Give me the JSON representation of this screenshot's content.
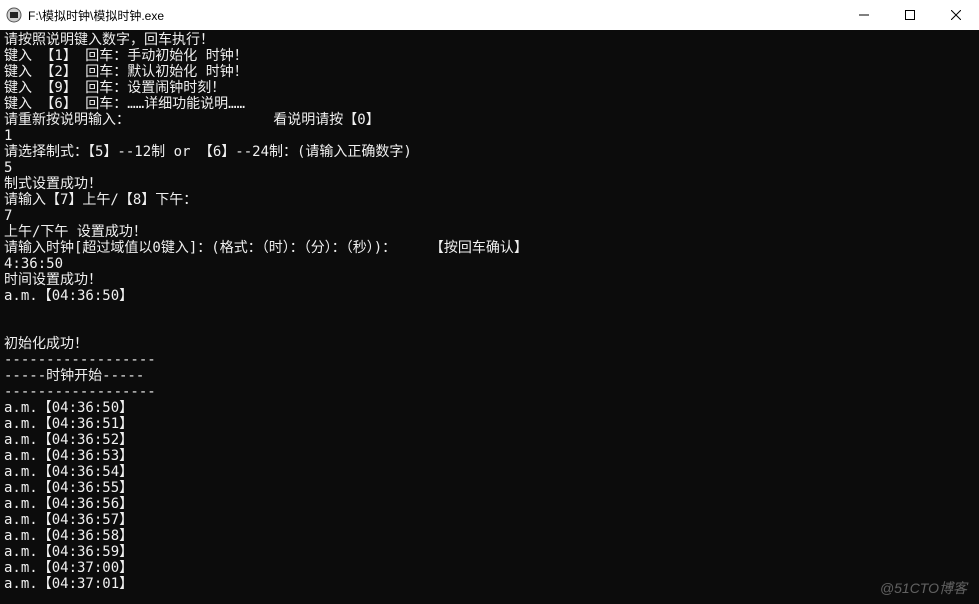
{
  "window": {
    "title": "F:\\模拟时钟\\模拟时钟.exe"
  },
  "controls": {
    "minimize": "—",
    "maximize": "□",
    "close": "×"
  },
  "console": {
    "lines": [
      "请按照说明键入数字，回车执行！",
      "键入 【1】 回车：手动初始化 时钟！",
      "键入 【2】 回车：默认初始化 时钟！",
      "键入 【9】 回车：设置闹钟时刻！",
      "键入 【6】 回车：……详细功能说明……",
      "请重新按说明输入：                 看说明请按【0】",
      "1",
      "请选择制式：【5】--12制 or 【6】--24制：(请输入正确数字)",
      "5",
      "制式设置成功！",
      "请输入【7】上午/【8】下午：",
      "7",
      "上午/下午 设置成功！",
      "请输入时钟[超过域值以0键入]：(格式：（时）：（分）：（秒）)：    【按回车确认】",
      "4:36:50",
      "时间设置成功！",
      "a.m.【04:36:50】",
      "",
      "",
      "初始化成功！",
      "------------------",
      "-----时钟开始-----",
      "------------------",
      "a.m.【04:36:50】",
      "a.m.【04:36:51】",
      "a.m.【04:36:52】",
      "a.m.【04:36:53】",
      "a.m.【04:36:54】",
      "a.m.【04:36:55】",
      "a.m.【04:36:56】",
      "a.m.【04:36:57】",
      "a.m.【04:36:58】",
      "a.m.【04:36:59】",
      "a.m.【04:37:00】",
      "a.m.【04:37:01】"
    ]
  },
  "watermark": "@51CTO博客"
}
